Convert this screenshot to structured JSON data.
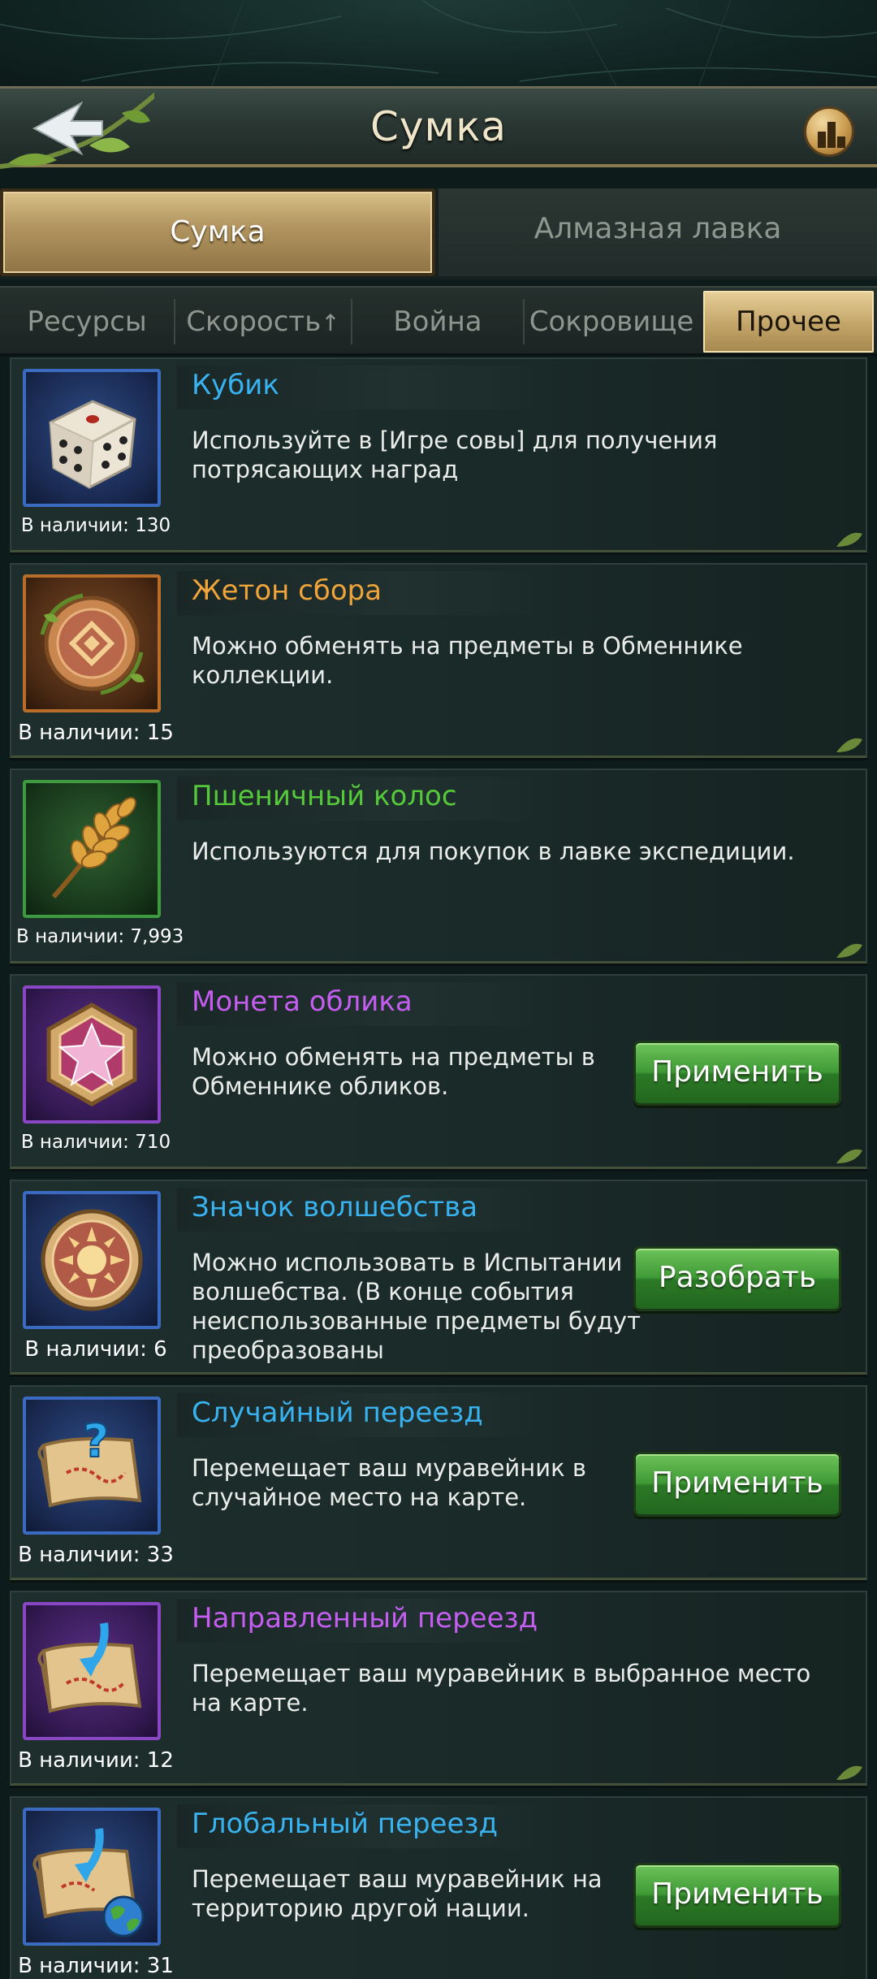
{
  "header": {
    "title": "Сумка"
  },
  "main_tabs": [
    {
      "label": "Сумка",
      "active": true
    },
    {
      "label": "Алмазная лавка",
      "active": false
    }
  ],
  "sub_tabs": [
    {
      "label": "Ресурсы",
      "active": false
    },
    {
      "label": "Скорость",
      "active": false
    },
    {
      "label": "Война",
      "active": false
    },
    {
      "label": "Сокровище",
      "active": false
    },
    {
      "label": "Прочее",
      "active": true
    }
  ],
  "items": [
    {
      "name": "Кубик",
      "desc": "Используйте в [Игре совы] для получения потрясающих наград",
      "stock": "В наличии: 130",
      "name_color": "#39b3f0",
      "icon": "dice-icon",
      "frame": "blue",
      "button": null
    },
    {
      "name": "Жетон сбора",
      "desc": "Можно обменять на предметы в Обменнике коллекции.",
      "stock": "В наличии: 15",
      "name_color": "#f0a43a",
      "icon": "collection-token-icon",
      "frame": "orange",
      "button": null
    },
    {
      "name": "Пшеничный колос",
      "desc": "Используются для покупок в лавке экспедиции.",
      "stock": "В наличии: 7,993",
      "name_color": "#55c93a",
      "icon": "wheat-icon",
      "frame": "green",
      "button": null
    },
    {
      "name": "Монета облика",
      "desc": "Можно обменять на предметы в Обменнике обликов.",
      "stock": "В наличии: 710",
      "name_color": "#c55ef0",
      "icon": "skin-coin-icon",
      "frame": "purple",
      "button": "Применить"
    },
    {
      "name": "Значок волшебства",
      "desc": "Можно использовать в Испытании волшебства. (В конце события неиспользованные предметы будут преобразованы",
      "stock": "В наличии: 6",
      "name_color": "#39b3f0",
      "icon": "magic-badge-icon",
      "frame": "blue",
      "button": "Разобрать"
    },
    {
      "name": "Случайный переезд",
      "desc": "Перемещает ваш муравейник в случайное место на карте.",
      "stock": "В наличии: 33",
      "name_color": "#39b3f0",
      "icon": "random-relocation-icon",
      "frame": "blue",
      "button": "Применить"
    },
    {
      "name": "Направленный переезд",
      "desc": "Перемещает ваш муравейник в выбранное место на карте.",
      "stock": "В наличии: 12",
      "name_color": "#c55ef0",
      "icon": "targeted-relocation-icon",
      "frame": "purple",
      "button": null
    },
    {
      "name": "Глобальный переезд",
      "desc": "Перемещает ваш муравейник на территорию другой нации.",
      "stock": "В наличии: 31",
      "name_color": "#39b3f0",
      "icon": "global-relocation-icon",
      "frame": "blue",
      "button": "Применить"
    }
  ]
}
